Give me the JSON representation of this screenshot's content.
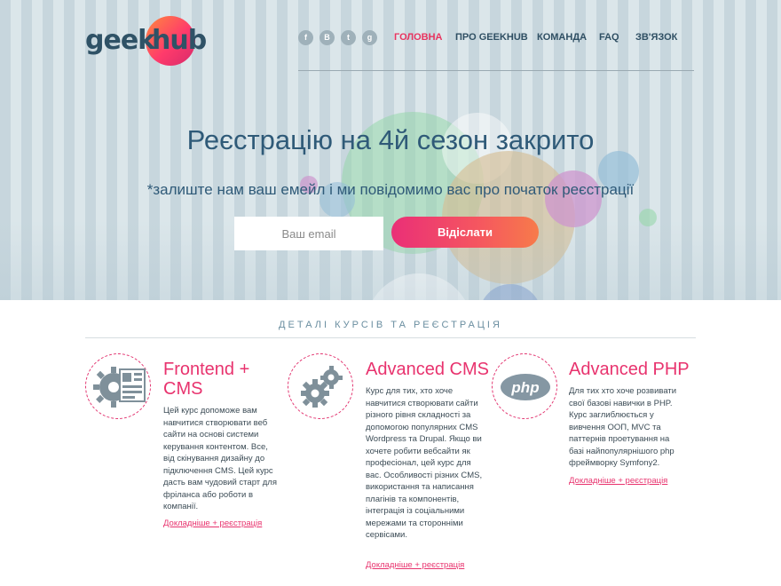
{
  "brand": {
    "logo_part1": "geek",
    "logo_part2": "hub",
    "accent": "#e8335f"
  },
  "social": [
    {
      "icon": "facebook-icon",
      "glyph": "f"
    },
    {
      "icon": "vk-icon",
      "glyph": "B"
    },
    {
      "icon": "twitter-icon",
      "glyph": "t"
    },
    {
      "icon": "google-plus-icon",
      "glyph": "g"
    }
  ],
  "nav": {
    "items": [
      {
        "label": "Головна",
        "active": true
      },
      {
        "label": "Про GeekHub",
        "active": false
      },
      {
        "label": "Команда",
        "active": false
      },
      {
        "label": "FAQ",
        "active": false
      },
      {
        "label": "Зв'язок",
        "active": false
      }
    ]
  },
  "hero": {
    "title": "Реєстрацію на 4й сезон закрито",
    "subtitle": "*залиште нам ваш емейл і ми повідомимо вас про початок реєстрації",
    "email_placeholder": "Ваш email",
    "submit_label": "Відіслати"
  },
  "courses_section": {
    "title": "Деталі курсів та реєстрація",
    "courses": [
      {
        "icon": "frontend-cms-icon",
        "title": "Frontend + CMS",
        "description": "Цей курс допоможе вам навчитися створювати веб сайти на основі системи керування контентом. Все, від скінування дизайну до підключення CMS. Цей курс дасть вам чудовий старт для фріланса або роботи в компанії.",
        "link": "Докладніше + реєстрація"
      },
      {
        "icon": "gears-icon",
        "title": "Advanced CMS",
        "description": "Курс для тих, хто хоче навчитися створювати сайти різного рівня складності за допомогою популярних CMS Wordpress та Drupal. Якщо ви хочете робити вебсайти як професіонал, цей курс для вас. Особливості різних CMS, використання та написання плагінів та компонентів, інтеграція із соціальними мережами та сторонніми сервісами.",
        "link": "Докладніше + реєстрація"
      },
      {
        "icon": "php-icon",
        "title": "Advanced PHP",
        "description": "Для тих хто хоче розвивати свої базові навички в PHP. Курс заглиблюється у вивчення ООП, MVC та паттернів проетування на базі найпопулярнішого php фреймворку Symfony2.",
        "link": "Докладніше + реєстрація"
      }
    ]
  }
}
